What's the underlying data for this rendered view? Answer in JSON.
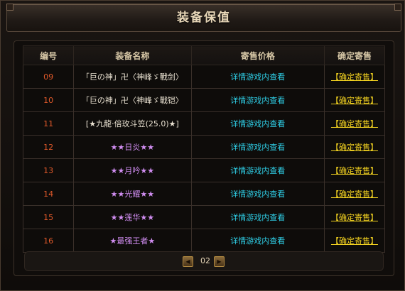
{
  "window": {
    "title": "装备保值"
  },
  "table": {
    "headers": [
      "编号",
      "装备名称",
      "寄售价格",
      "确定寄售"
    ],
    "rows": [
      {
        "num": "09",
        "name": "「巨の神」卍〈神峰ゞ戰剑〉",
        "price": "详情游戏内查看",
        "action": "【确定寄售】"
      },
      {
        "num": "10",
        "name": "「巨の神」卍〈神峰ゞ戰铠〉",
        "price": "详情游戏内查看",
        "action": "【确定寄售】"
      },
      {
        "num": "11",
        "name": "[★九龍·倍玫斗笠(25.0)★]",
        "price": "详情游戏内查看",
        "action": "【确定寄售】"
      },
      {
        "num": "12",
        "name": "★★日炎★★",
        "price": "详情游戏内查看",
        "action": "【确定寄售】"
      },
      {
        "num": "13",
        "name": "★★月吟★★",
        "price": "详情游戏内查看",
        "action": "【确定寄售】"
      },
      {
        "num": "14",
        "name": "★★光耀★★",
        "price": "详情游戏内查看",
        "action": "【确定寄售】"
      },
      {
        "num": "15",
        "name": "★★莲华★★",
        "price": "详情游戏内查看",
        "action": "【确定寄售】"
      },
      {
        "num": "16",
        "name": "★最强王者★",
        "price": "详情游戏内查看",
        "action": "【确定寄售】"
      }
    ]
  },
  "pager": {
    "page": "02",
    "prev_icon": "prev-arrow-icon",
    "next_icon": "next-arrow-icon"
  },
  "colors": {
    "number": "#e25a2a",
    "name": "#e8e0d0",
    "name_star": "#d18ef2",
    "price": "#2fd0e8",
    "action": "#f0d020"
  }
}
